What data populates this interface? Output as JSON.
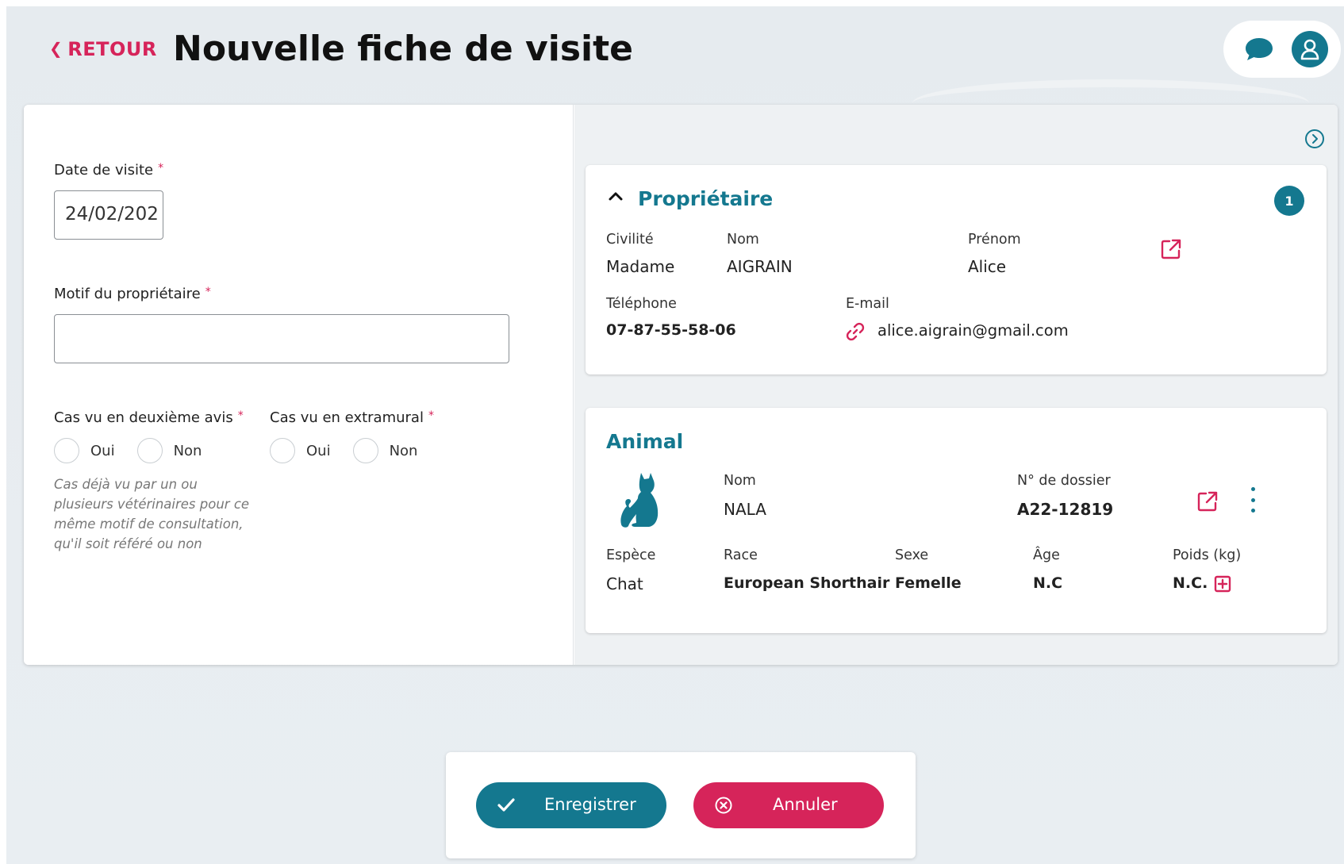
{
  "header": {
    "back_label": "RETOUR",
    "title": "Nouvelle fiche de visite"
  },
  "form": {
    "date_label": "Date de visite",
    "date_value": "24/02/202",
    "required_mark": "*",
    "motif_label": "Motif du propriétaire",
    "motif_value": "",
    "second_opinion_label": "Cas vu en deuxième avis",
    "extramural_label": "Cas vu en extramural",
    "yes_label": "Oui",
    "no_label": "Non",
    "hint": "Cas déjà vu par un ou plusieurs vétérinaires pour ce même motif de consultation, qu'il soit référé ou non"
  },
  "owner": {
    "title": "Propriétaire",
    "count": "1",
    "civility_label": "Civilité",
    "civility_value": "Madame",
    "lastname_label": "Nom",
    "lastname_value": "AIGRAIN",
    "firstname_label": "Prénom",
    "firstname_value": "Alice",
    "phone_label": "Téléphone",
    "phone_value": "07-87-55-58-06",
    "email_label": "E-mail",
    "email_value": "alice.aigrain@gmail.com"
  },
  "animal": {
    "title": "Animal",
    "name_label": "Nom",
    "name_value": "NALA",
    "file_label": "N° de dossier",
    "file_value": "A22-12819",
    "species_label": "Espèce",
    "species_value": "Chat",
    "breed_label": "Race",
    "breed_value": "European Shorthair",
    "sex_label": "Sexe",
    "sex_value": "Femelle",
    "age_label": "Âge",
    "age_value": "N.C",
    "weight_label": "Poids (kg)",
    "weight_value": "N.C."
  },
  "actions": {
    "save_label": "Enregistrer",
    "cancel_label": "Annuler"
  },
  "colors": {
    "accent": "#14788f",
    "danger": "#d6245a"
  }
}
